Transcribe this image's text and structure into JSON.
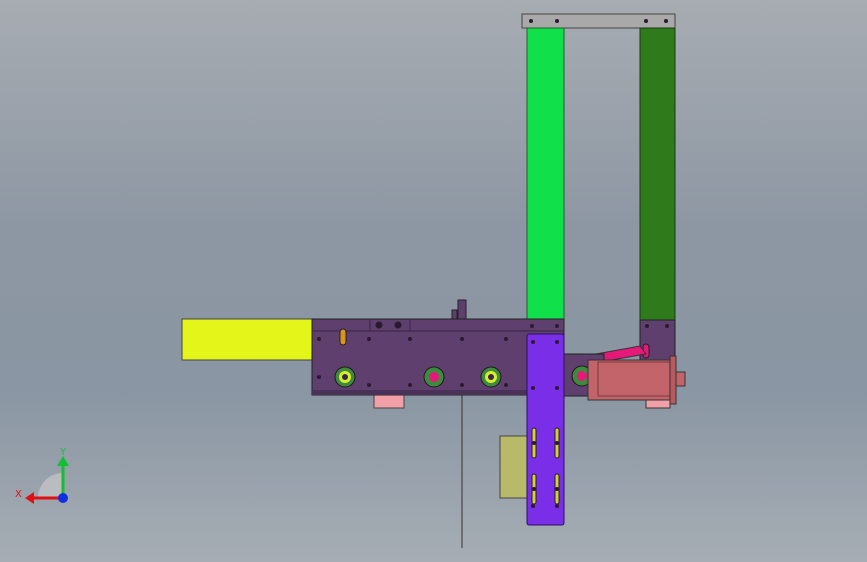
{
  "view": {
    "background_top": "#a7acb2",
    "background_bottom": "#8a96a3"
  },
  "model": {
    "colors": {
      "top_bar": "#a9a9a9",
      "left_column": "#10e04a",
      "right_column": "#2f7a1a",
      "main_plate": "#5e3f6e",
      "yellow_block": "#e4f51a",
      "purple_bracket": "#7a2ee8",
      "motor": "#c3646a",
      "pink_part": "#f2a0a8",
      "olive_part": "#b9b96a",
      "magenta": "#e6197a",
      "bolt": "#2a1a2e"
    }
  },
  "triad": {
    "x_label": "X",
    "y_label": "Y",
    "x_color": "#e01010",
    "y_color": "#10c030",
    "z_color": "#1030e0"
  }
}
